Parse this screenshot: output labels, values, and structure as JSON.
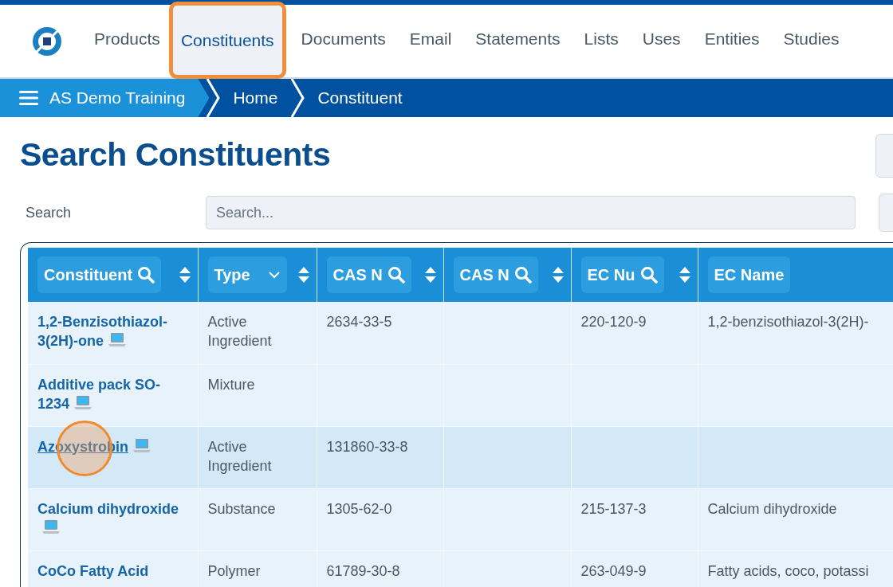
{
  "nav": {
    "items": [
      {
        "label": "Products",
        "selected": false,
        "highlighted": false
      },
      {
        "label": "Constituents",
        "selected": true,
        "highlighted": true
      },
      {
        "label": "Documents",
        "selected": false,
        "highlighted": false
      },
      {
        "label": "Email",
        "selected": false,
        "highlighted": false
      },
      {
        "label": "Statements",
        "selected": false,
        "highlighted": false
      },
      {
        "label": "Lists",
        "selected": false,
        "highlighted": false
      },
      {
        "label": "Uses",
        "selected": false,
        "highlighted": false
      },
      {
        "label": "Entities",
        "selected": false,
        "highlighted": false
      },
      {
        "label": "Studies",
        "selected": false,
        "highlighted": false
      }
    ]
  },
  "breadcrumb": [
    "AS Demo Training",
    "Home",
    "Constituent"
  ],
  "title": "Search Constituents",
  "search": {
    "label": "Search",
    "placeholder": "Search..."
  },
  "table": {
    "columns": [
      {
        "label": "Constituent",
        "kind": "search",
        "sortable": true
      },
      {
        "label": "Type",
        "kind": "select",
        "sortable": true
      },
      {
        "label": "CAS N",
        "kind": "search",
        "sortable": true
      },
      {
        "label": "CAS N",
        "kind": "search",
        "sortable": true
      },
      {
        "label": "EC Nu",
        "kind": "search",
        "sortable": true
      },
      {
        "label": "EC Name",
        "kind": "plain",
        "sortable": false
      }
    ],
    "rows": [
      {
        "constituent": "1,2-Benzisothiazol-3(2H)-one",
        "device_icon": true,
        "type": "Active Ingredient",
        "cas_number": "2634-33-5",
        "ec_number": "220-120-9",
        "ec_name": "1,2-benzisothiazol-3(2H)-",
        "hovered": false,
        "clicked": false
      },
      {
        "constituent": "Additive pack SO-1234",
        "device_icon": true,
        "type": "Mixture",
        "hovered": false,
        "clicked": false
      },
      {
        "constituent": "Azoxystrobin",
        "device_icon": true,
        "type": "Active Ingredient",
        "cas_number": "131860-33-8",
        "hovered": true,
        "clicked": true
      },
      {
        "constituent": "Calcium dihydroxide",
        "device_icon": true,
        "type": "Substance",
        "cas_number": "1305-62-0",
        "ec_number": "215-137-3",
        "ec_name": "Calcium dihydroxide",
        "hovered": false,
        "clicked": false
      },
      {
        "constituent": "CoCo Fatty Acid",
        "device_icon": false,
        "type": "Polymer",
        "cas_number": "61789-30-8",
        "ec_number": "263-049-9",
        "ec_name": "Fatty acids, coco, potassi",
        "hovered": false,
        "clicked": false
      }
    ]
  }
}
